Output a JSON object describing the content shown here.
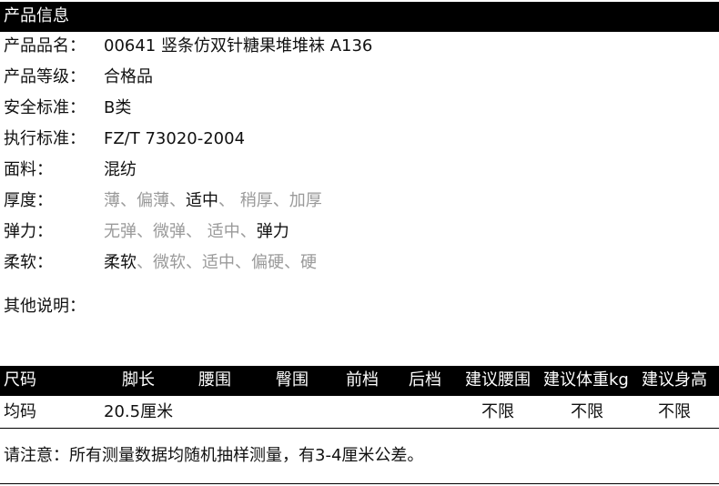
{
  "section_title": "产品信息",
  "info": [
    {
      "label": "产品品名：",
      "value": "00641 竖条仿双针糖果堆堆袜 A136"
    },
    {
      "label": "产品等级：",
      "value": "合格品"
    },
    {
      "label": "安全标准：",
      "value": "B类"
    },
    {
      "label": "执行标准：",
      "value": "FZ/T 73020-2004"
    },
    {
      "label": "面料：",
      "value": "混纺"
    }
  ],
  "thickness": {
    "label": "厚度：",
    "opt1": "薄、偏薄、",
    "selected": "适中",
    "opt2": "、 稍厚、加厚"
  },
  "elasticity": {
    "label": "弹力：",
    "opt1": "无弹、微弹、 适中、",
    "selected": "弹力"
  },
  "softness": {
    "label": "柔软：",
    "selected": "柔软",
    "opt2": "、微软、适中、偏硬、硬"
  },
  "other_notes": {
    "label": "其他说明："
  },
  "size_table": {
    "headers": [
      "尺码",
      "脚长",
      "腰围",
      "臀围",
      "前档",
      "后档",
      "建议腰围",
      "建议体重kg",
      "建议身高"
    ],
    "row": [
      "均码",
      "20.5厘米",
      "",
      "",
      "",
      "",
      "不限",
      "不限",
      "不限"
    ]
  },
  "note": "请注意：所有测量数据均随机抽样测量，有3-4厘米公差。"
}
